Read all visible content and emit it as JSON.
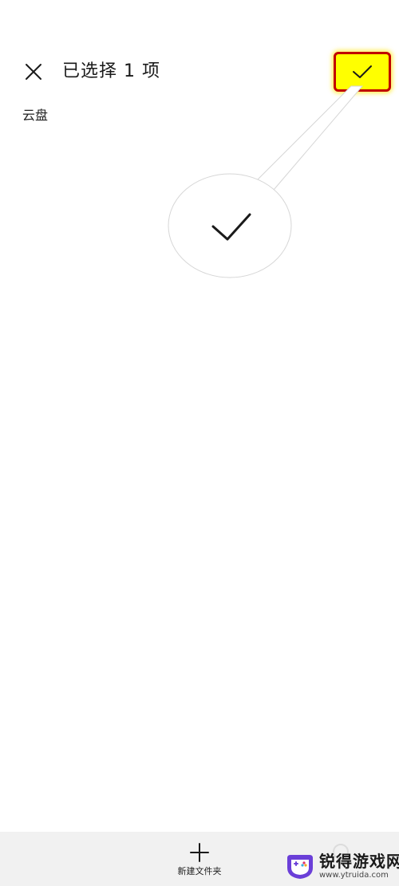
{
  "header": {
    "title": "已选择 1 项",
    "close_icon": "close-icon",
    "confirm_icon": "check-icon"
  },
  "content": {
    "section_label": "云盘"
  },
  "annotation": {
    "highlight_color": "#ffff00",
    "border_color": "#c00000",
    "magnified_icon": "check-icon"
  },
  "bottom_bar": {
    "new_folder_label": "新建文件夹",
    "new_folder_icon": "plus-icon"
  },
  "watermark": {
    "name": "锐得游戏网",
    "url": "www.ytruida.com"
  }
}
